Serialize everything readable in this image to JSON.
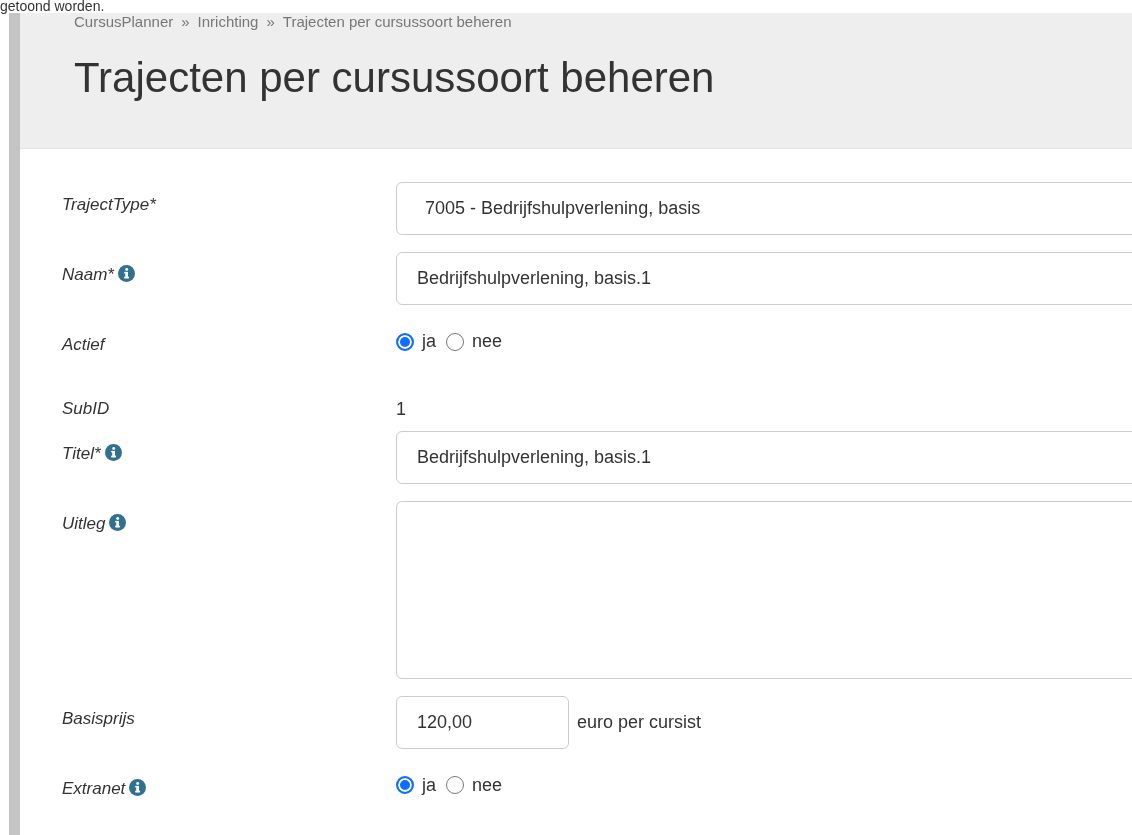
{
  "intro_text": "getoond worden.",
  "breadcrumb": [
    "CursusPlanner",
    "Inrichting",
    "Trajecten per cursussoort beheren"
  ],
  "breadcrumb_separator": "»",
  "title": "Trajecten per cursussoort beheren",
  "fields": [
    {
      "kind": "select",
      "label": "TrajectType*",
      "info": false,
      "value": "7005 - Bedrijfshulpverlening, basis"
    },
    {
      "kind": "input",
      "label": "Naam*",
      "info": true,
      "value": "Bedrijfshulpverlening, basis.1"
    },
    {
      "kind": "radio",
      "label": "Actief",
      "info": false,
      "options": [
        {
          "label": "ja",
          "selected": true
        },
        {
          "label": "nee",
          "selected": false
        }
      ]
    },
    {
      "kind": "static",
      "label": "SubID",
      "info": false,
      "value": "1"
    },
    {
      "kind": "input",
      "label": "Titel*",
      "info": true,
      "value": "Bedrijfshulpverlening, basis.1"
    },
    {
      "kind": "textarea",
      "label": "Uitleg",
      "info": true
    },
    {
      "kind": "price",
      "label": "Basisprijs",
      "info": false,
      "value": "120,00",
      "suffix": "euro per cursist"
    },
    {
      "kind": "radio",
      "label": "Extranet",
      "info": true,
      "options": [
        {
          "label": "ja",
          "selected": true
        },
        {
          "label": "nee",
          "selected": false
        }
      ]
    }
  ]
}
